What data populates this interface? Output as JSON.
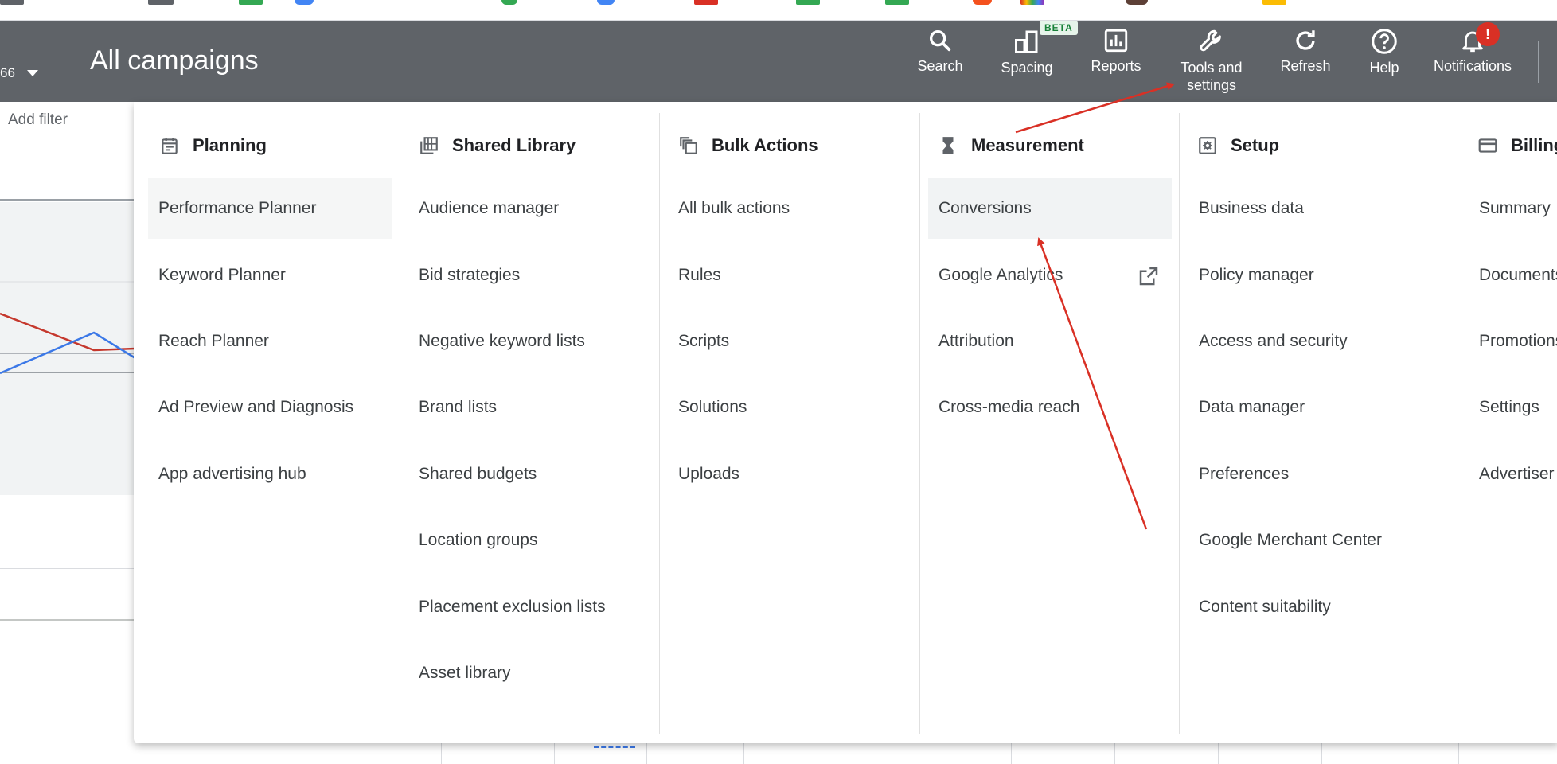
{
  "header": {
    "account_fragment": "66",
    "page_title": "All campaigns",
    "tools": [
      {
        "label": "Search",
        "icon": "search-icon"
      },
      {
        "label": "Spacing",
        "icon": "spacing-icon",
        "badge": "BETA"
      },
      {
        "label": "Reports",
        "icon": "reports-icon"
      },
      {
        "label": "Tools and settings",
        "icon": "wrench-icon"
      },
      {
        "label": "Refresh",
        "icon": "refresh-icon"
      },
      {
        "label": "Help",
        "icon": "help-icon"
      },
      {
        "label": "Notifications",
        "icon": "bell-icon",
        "badge": "!"
      }
    ]
  },
  "filter": {
    "placeholder": "Add filter"
  },
  "menu": {
    "columns": [
      {
        "title": "Planning",
        "icon": "calendar-icon",
        "items": [
          "Performance Planner",
          "Keyword Planner",
          "Reach Planner",
          "Ad Preview and Diagnosis",
          "App advertising hub"
        ]
      },
      {
        "title": "Shared Library",
        "icon": "library-icon",
        "items": [
          "Audience manager",
          "Bid strategies",
          "Negative keyword lists",
          "Brand lists",
          "Shared budgets",
          "Location groups",
          "Placement exclusion lists",
          "Asset library"
        ]
      },
      {
        "title": "Bulk Actions",
        "icon": "copy-icon",
        "items": [
          "All bulk actions",
          "Rules",
          "Scripts",
          "Solutions",
          "Uploads"
        ]
      },
      {
        "title": "Measurement",
        "icon": "hourglass-icon",
        "items": [
          "Conversions",
          "Google Analytics",
          "Attribution",
          "Cross-media reach"
        ]
      },
      {
        "title": "Setup",
        "icon": "settings-icon",
        "items": [
          "Business data",
          "Policy manager",
          "Access and security",
          "Data manager",
          "Preferences",
          "Google Merchant Center",
          "Content suitability"
        ]
      },
      {
        "title": "Billing",
        "icon": "credit-card-icon",
        "items": [
          "Summary",
          "Documents",
          "Promotions",
          "Settings",
          "Advertiser"
        ]
      }
    ]
  },
  "colors": {
    "topbar": "#5f6368",
    "annotation": "#d93025",
    "beta_bg": "#e6f4ea",
    "beta_text": "#188038",
    "line_red": "#c5382d",
    "line_blue": "#3b78e7"
  }
}
